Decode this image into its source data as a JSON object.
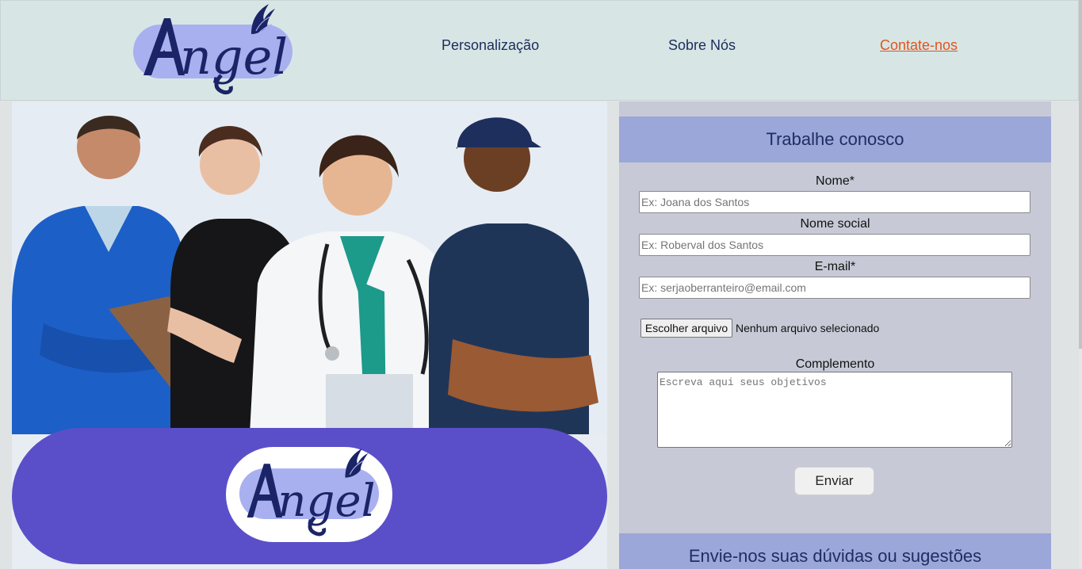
{
  "header": {
    "logo_text": "Angel",
    "nav": [
      {
        "label": "Personalização",
        "active": false
      },
      {
        "label": "Sobre Nós",
        "active": false
      },
      {
        "label": "Contate-nos",
        "active": true
      }
    ]
  },
  "hero": {
    "image_description": "workers-group-photo",
    "banner_logo_text": "Angel"
  },
  "form": {
    "title": "Trabalhe conosco",
    "fields": {
      "name_label": "Nome*",
      "name_placeholder": "Ex: Joana dos Santos",
      "social_label": "Nome social",
      "social_placeholder": "Ex: Roberval dos Santos",
      "email_label": "E-mail*",
      "email_placeholder": "Ex: serjaoberranteiro@email.com"
    },
    "file": {
      "button_label": "Escolher arquivo",
      "status": "Nenhum arquivo selecionado"
    },
    "complement_label": "Complemento",
    "complement_placeholder": "Escreva aqui seus objetivos",
    "submit_label": "Enviar"
  },
  "feedback": {
    "title": "Envie-nos suas dúvidas ou sugestões"
  },
  "colors": {
    "header_bg": "#d7e6e5",
    "nav_text": "#1c2c5c",
    "nav_active": "#e2541f",
    "banner": "#5a4fc9",
    "logo_pill": "#a9b0ef",
    "section_header": "#9ba7d8",
    "form_bg": "#c7cad6"
  }
}
